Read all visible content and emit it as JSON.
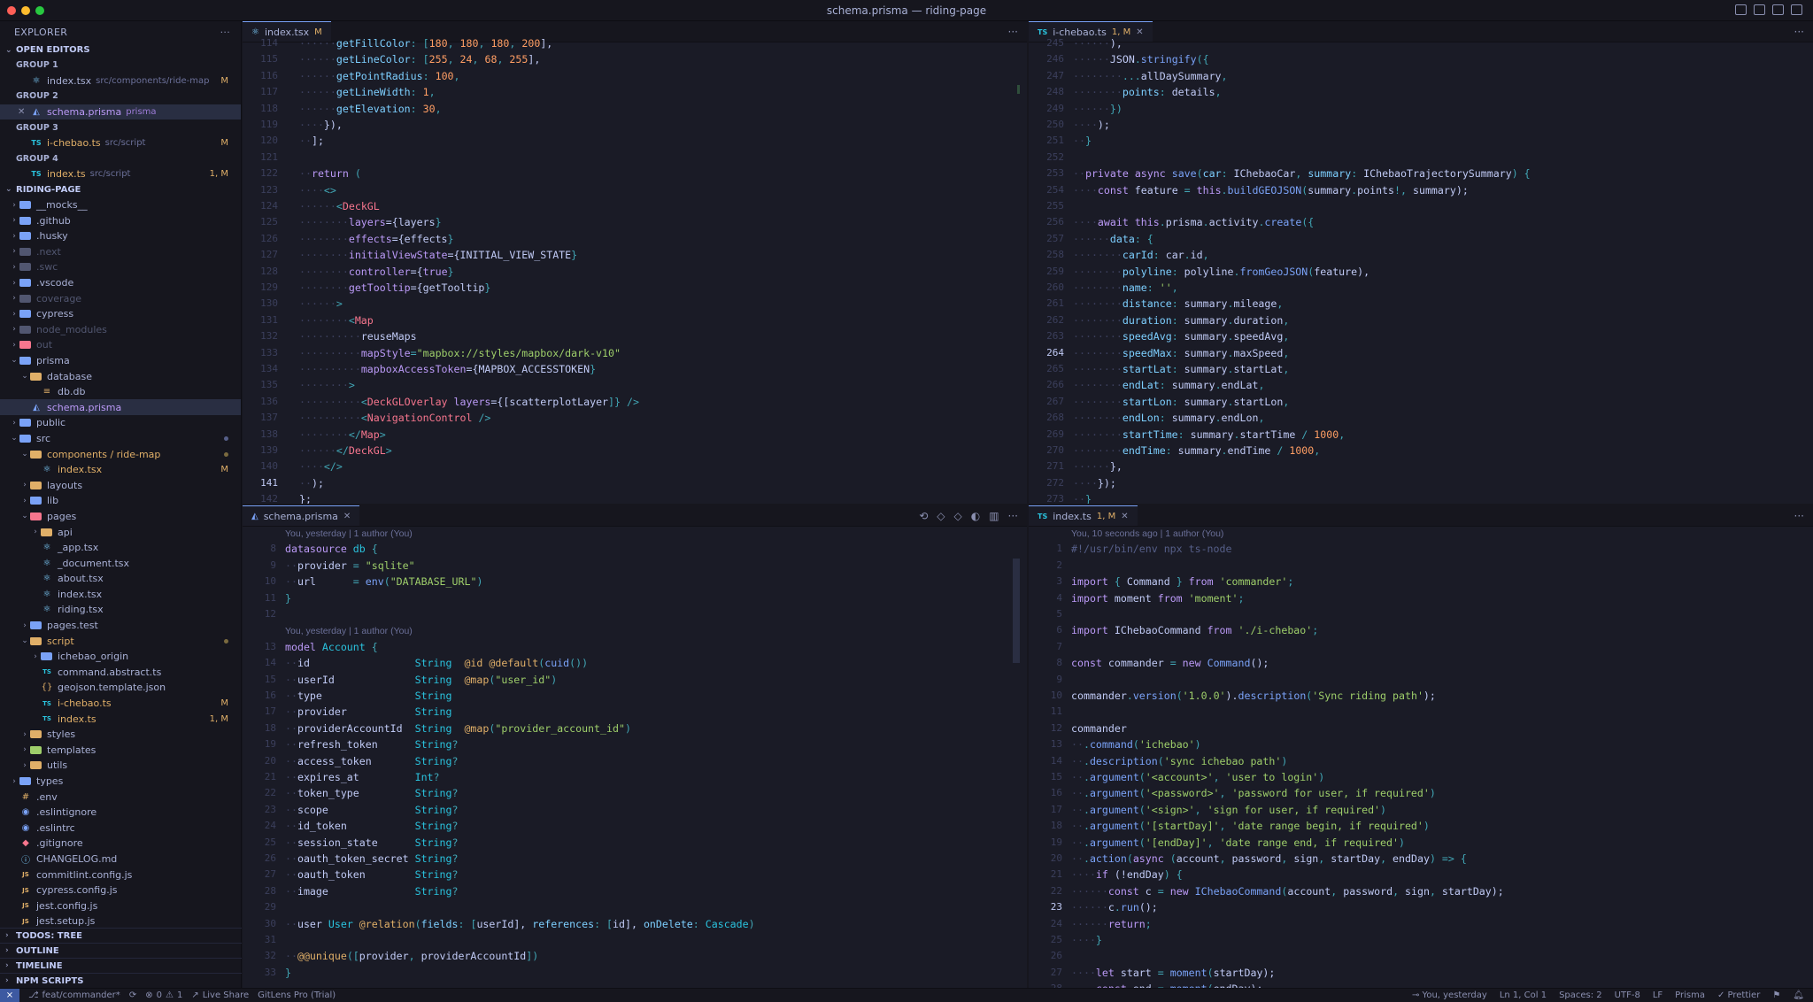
{
  "window": {
    "title": "schema.prisma — riding-page"
  },
  "colors": {
    "close": "#ff5f57",
    "minimize": "#febc2e",
    "zoom": "#28c840",
    "accent": "#7aa2f7"
  },
  "sidebar": {
    "header": "EXPLORER",
    "open_editors": {
      "label": "OPEN EDITORS",
      "groups": [
        {
          "label": "GROUP 1",
          "file": "index.tsx",
          "path": "src/components/ride-map",
          "badge": "M"
        },
        {
          "label": "GROUP 2",
          "file": "schema.prisma",
          "path": "prisma",
          "badge": ""
        },
        {
          "label": "GROUP 3",
          "file": "i-chebao.ts",
          "path": "src/script",
          "badge": "M"
        },
        {
          "label": "GROUP 4",
          "file": "index.ts",
          "path": "src/script",
          "badge": "1, M"
        }
      ]
    },
    "project": "RIDING-PAGE",
    "tree": {
      "mocks": "__mocks__",
      "github": ".github",
      "husky": ".husky",
      "next": ".next",
      "swc": ".swc",
      "vscode": ".vscode",
      "coverage": "coverage",
      "cypress": "cypress",
      "node_modules": "node_modules",
      "out": "out",
      "prisma": "prisma",
      "database": "database",
      "dbdb": "db.db",
      "schema": "schema.prisma",
      "public": "public",
      "src": "src",
      "components": "components / ride-map",
      "index_tsx": "index.tsx",
      "layouts": "layouts",
      "lib": "lib",
      "pages": "pages",
      "api": "api",
      "app": "_app.tsx",
      "document": "_document.tsx",
      "about": "about.tsx",
      "pindex": "index.tsx",
      "riding": "riding.tsx",
      "pages_test": "pages.test",
      "script": "script",
      "ichebao_origin": "ichebao_origin",
      "command_abstract": "command.abstract.ts",
      "geojson": "geojson.template.json",
      "ichebao": "i-chebao.ts",
      "sindex": "index.ts",
      "styles": "styles",
      "templates": "templates",
      "utils": "utils",
      "types": "types",
      "env": ".env",
      "eslintignore": ".eslintignore",
      "eslintrc": ".eslintrc",
      "gitignore": ".gitignore",
      "changelog": "CHANGELOG.md",
      "commitlint": "commitlint.config.js",
      "cypress_config": "cypress.config.js",
      "jest_config": "jest.config.js",
      "jest_setup": "jest.setup.js",
      "badge_m": "M",
      "badge_1m": "1, M"
    },
    "bottom": [
      "TODOS: TREE",
      "OUTLINE",
      "TIMELINE",
      "NPM SCRIPTS"
    ]
  },
  "editors": {
    "tl": {
      "tab": "index.tsx",
      "mod": "M"
    },
    "tr": {
      "tab": "i-chebao.ts",
      "mod": "1, M"
    },
    "bl": {
      "tab": "schema.prisma",
      "blame1": "You, yesterday | 1 author (You)",
      "blame2": "You, yesterday | 1 author (You)"
    },
    "br": {
      "tab": "index.ts",
      "mod": "1, M",
      "blame": "You, 10 seconds ago | 1 author (You)"
    }
  },
  "code": {
    "tl": [
      [
        "114",
        "      getFillColor: [180, 180, 180, 200],"
      ],
      [
        "115",
        "      getLineColor: [255, 24, 68, 255],"
      ],
      [
        "116",
        "      getPointRadius: 100,"
      ],
      [
        "117",
        "      getLineWidth: 1,"
      ],
      [
        "118",
        "      getElevation: 30,"
      ],
      [
        "119",
        "    }),"
      ],
      [
        "120",
        "  ];"
      ],
      [
        "121",
        ""
      ],
      [
        "122",
        "  return ("
      ],
      [
        "123",
        "    <>"
      ],
      [
        "124",
        "      <DeckGL"
      ],
      [
        "125",
        "        layers={layers}"
      ],
      [
        "126",
        "        effects={effects}"
      ],
      [
        "127",
        "        initialViewState={INITIAL_VIEW_STATE}"
      ],
      [
        "128",
        "        controller={true}"
      ],
      [
        "129",
        "        getTooltip={getTooltip}"
      ],
      [
        "130",
        "      >"
      ],
      [
        "131",
        "        <Map"
      ],
      [
        "132",
        "          reuseMaps"
      ],
      [
        "133",
        "          mapStyle=\"mapbox://styles/mapbox/dark-v10\""
      ],
      [
        "134",
        "          mapboxAccessToken={MAPBOX_ACCESSTOKEN}"
      ],
      [
        "135",
        "        >"
      ],
      [
        "136",
        "          <DeckGLOverlay layers={[scatterplotLayer]} />"
      ],
      [
        "137",
        "          <NavigationControl />"
      ],
      [
        "138",
        "        </Map>"
      ],
      [
        "139",
        "      </DeckGL>"
      ],
      [
        "140",
        "    </>"
      ],
      [
        "141",
        "  );"
      ],
      [
        "142",
        "};"
      ]
    ],
    "tr": [
      [
        "245",
        "      ),"
      ],
      [
        "246",
        "      JSON.stringify({"
      ],
      [
        "247",
        "        ...allDaySummary,"
      ],
      [
        "248",
        "        points: details,"
      ],
      [
        "249",
        "      })"
      ],
      [
        "250",
        "    );"
      ],
      [
        "251",
        "  }"
      ],
      [
        "252",
        ""
      ],
      [
        "253",
        "  private async save(car: IChebaoCar, summary: IChebaoTrajectorySummary) {"
      ],
      [
        "254",
        "    const feature = this.buildGEOJSON(summary.points!, summary);"
      ],
      [
        "255",
        ""
      ],
      [
        "256",
        "    await this.prisma.activity.create({"
      ],
      [
        "257",
        "      data: {"
      ],
      [
        "258",
        "        carId: car.id,"
      ],
      [
        "259",
        "        polyline: polyline.fromGeoJSON(feature),"
      ],
      [
        "260",
        "        name: '',"
      ],
      [
        "261",
        "        distance: summary.mileage,"
      ],
      [
        "262",
        "        duration: summary.duration,"
      ],
      [
        "263",
        "        speedAvg: summary.speedAvg,"
      ],
      [
        "264",
        "        speedMax: summary.maxSpeed,"
      ],
      [
        "265",
        "        startLat: summary.startLat,"
      ],
      [
        "266",
        "        endLat: summary.endLat,"
      ],
      [
        "267",
        "        startLon: summary.startLon,"
      ],
      [
        "268",
        "        endLon: summary.endLon,"
      ],
      [
        "269",
        "        startTime: summary.startTime / 1000,"
      ],
      [
        "270",
        "        endTime: summary.endTime / 1000,"
      ],
      [
        "271",
        "      },"
      ],
      [
        "272",
        "    });"
      ],
      [
        "273",
        "  }"
      ]
    ],
    "bl": [
      [
        "8",
        "datasource db {"
      ],
      [
        "9",
        "  provider = \"sqlite\""
      ],
      [
        "10",
        "  url      = env(\"DATABASE_URL\")"
      ],
      [
        "11",
        "}"
      ],
      [
        "12",
        ""
      ],
      [
        "13",
        "model Account {"
      ],
      [
        "14",
        "  id                 String  @id @default(cuid())"
      ],
      [
        "15",
        "  userId             String  @map(\"user_id\")"
      ],
      [
        "16",
        "  type               String"
      ],
      [
        "17",
        "  provider           String"
      ],
      [
        "18",
        "  providerAccountId  String  @map(\"provider_account_id\")"
      ],
      [
        "19",
        "  refresh_token      String?"
      ],
      [
        "20",
        "  access_token       String?"
      ],
      [
        "21",
        "  expires_at         Int?"
      ],
      [
        "22",
        "  token_type         String?"
      ],
      [
        "23",
        "  scope              String?"
      ],
      [
        "24",
        "  id_token           String?"
      ],
      [
        "25",
        "  session_state      String?"
      ],
      [
        "26",
        "  oauth_token_secret String?"
      ],
      [
        "27",
        "  oauth_token        String?"
      ],
      [
        "28",
        "  image              String?"
      ],
      [
        "29",
        ""
      ],
      [
        "30",
        "  user User @relation(fields: [userId], references: [id], onDelete: Cascade)"
      ],
      [
        "31",
        ""
      ],
      [
        "32",
        "  @@unique([provider, providerAccountId])"
      ],
      [
        "33",
        "}"
      ]
    ],
    "br": [
      [
        "1",
        "#!/usr/bin/env npx ts-node"
      ],
      [
        "2",
        ""
      ],
      [
        "3",
        "import { Command } from 'commander';"
      ],
      [
        "4",
        "import moment from 'moment';"
      ],
      [
        "5",
        ""
      ],
      [
        "6",
        "import IChebaoCommand from './i-chebao';"
      ],
      [
        "7",
        ""
      ],
      [
        "8",
        "const commander = new Command();"
      ],
      [
        "9",
        ""
      ],
      [
        "10",
        "commander.version('1.0.0').description('Sync riding path');"
      ],
      [
        "11",
        ""
      ],
      [
        "12",
        "commander"
      ],
      [
        "13",
        "  .command('ichebao')"
      ],
      [
        "14",
        "  .description('sync ichebao path')"
      ],
      [
        "15",
        "  .argument('<account>', 'user to login')"
      ],
      [
        "16",
        "  .argument('<password>', 'password for user, if required')"
      ],
      [
        "17",
        "  .argument('<sign>', 'sign for user, if required')"
      ],
      [
        "18",
        "  .argument('[startDay]', 'date range begin, if required')"
      ],
      [
        "19",
        "  .argument('[endDay]', 'date range end, if required')"
      ],
      [
        "20",
        "  .action(async (account, password, sign, startDay, endDay) => {"
      ],
      [
        "21",
        "    if (!endDay) {"
      ],
      [
        "22",
        "      const c = new IChebaoCommand(account, password, sign, startDay);"
      ],
      [
        "23",
        "      c.run();"
      ],
      [
        "24",
        "      return;"
      ],
      [
        "25",
        "    }"
      ],
      [
        "26",
        ""
      ],
      [
        "27",
        "    let start = moment(startDay);"
      ],
      [
        "28",
        "    const end = moment(endDay);"
      ]
    ]
  },
  "status": {
    "branch": "feat/commander*",
    "problems": "0",
    "warnings": "1",
    "live_share": "Live Share",
    "gitlens": "GitLens Pro (Trial)",
    "blame": "You, yesterday",
    "cursor": "Ln 1, Col 1",
    "spaces": "Spaces: 2",
    "encoding": "UTF-8",
    "eol": "LF",
    "language": "Prisma",
    "formatter": "Prettier"
  }
}
